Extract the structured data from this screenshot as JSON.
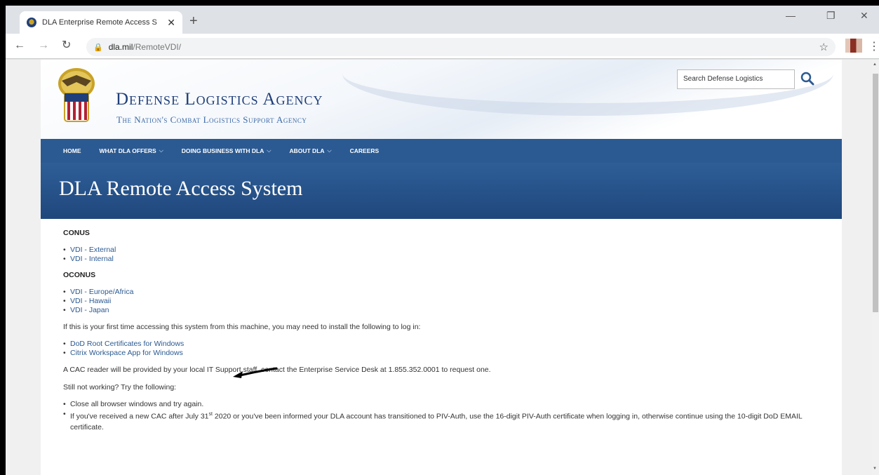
{
  "browser": {
    "tab_title": "DLA Enterprise Remote Access S",
    "url_host": "dla.mil",
    "url_path": "/RemoteVDI/"
  },
  "header": {
    "agency_name": "Defense Logistics Agency",
    "agency_tagline": "The Nation's Combat Logistics Support Agency",
    "search_placeholder": "Search Defense Logistics"
  },
  "nav": {
    "items": [
      {
        "label": "HOME"
      },
      {
        "label": "WHAT DLA OFFERS"
      },
      {
        "label": "DOING BUSINESS WITH DLA"
      },
      {
        "label": "ABOUT DLA"
      },
      {
        "label": "CAREERS"
      }
    ]
  },
  "page_title": "DLA Remote Access System",
  "conus": {
    "title": "CONUS",
    "links": [
      "VDI - External",
      "VDI - Internal"
    ]
  },
  "oconus": {
    "title": "OCONUS",
    "links": [
      "VDI - Europe/Africa",
      "VDI - Hawaii",
      "VDI - Japan"
    ]
  },
  "first_time_text": "If this is your first time accessing this system from this machine, you may need to install the following to log in:",
  "install_links": [
    "DoD Root Certificates for Windows",
    "Citrix Workspace App for Windows"
  ],
  "cac_text": "A CAC reader will be provided by your local IT Support staff, contact the Enterprise Service Desk at 1.855.352.0001 to request one.",
  "still_not_working": "Still not working? Try the following:",
  "tips": {
    "tip1": "Close all browser windows and try again.",
    "tip2_a": "If you've received a new CAC after July 31",
    "tip2_sup": "st",
    "tip2_b": " 2020 or you've been informed your DLA account has transitioned to PIV-Auth, use the 16-digit PIV-Auth certificate when logging in, otherwise continue using the 10-digit DoD EMAIL certificate."
  }
}
